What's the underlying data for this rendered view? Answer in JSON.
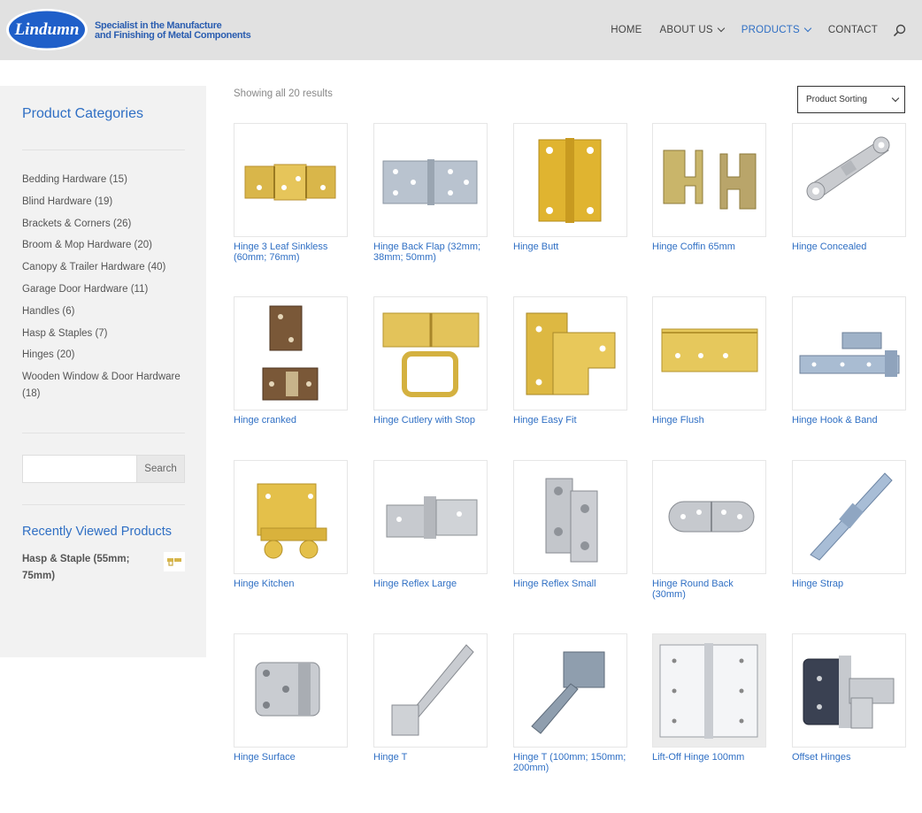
{
  "header": {
    "logo_text": "Lindumn",
    "tagline_line1": "Specialist in the Manufacture",
    "tagline_line2": "and Finishing of Metal Components",
    "nav": [
      {
        "label": "HOME",
        "has_dropdown": false,
        "active": false
      },
      {
        "label": "ABOUT US",
        "has_dropdown": true,
        "active": false
      },
      {
        "label": "PRODUCTS",
        "has_dropdown": true,
        "active": true
      },
      {
        "label": "CONTACT",
        "has_dropdown": false,
        "active": false
      }
    ],
    "search_icon": "search-icon"
  },
  "sidebar": {
    "categories_title": "Product Categories",
    "categories": [
      "Bedding Hardware (15)",
      "Blind Hardware (19)",
      "Brackets & Corners (26)",
      "Broom & Mop Hardware (20)",
      "Canopy & Trailer Hardware (40)",
      "Garage Door Hardware (11)",
      "Handles (6)",
      "Hasp & Staples (7)",
      "Hinges (20)",
      "Wooden Window & Door Hardware (18)"
    ],
    "search": {
      "placeholder": "",
      "button_label": "Search"
    },
    "recently_viewed_title": "Recently Viewed Products",
    "recently_viewed": [
      {
        "name": "Hasp & Staple (55mm; 75mm)"
      }
    ]
  },
  "main": {
    "results_text": "Showing all 20 results",
    "sorting_label": "Product Sorting",
    "products": [
      {
        "name": "Hinge 3 Leaf Sinkless (60mm; 76mm)"
      },
      {
        "name": "Hinge Back Flap (32mm; 38mm; 50mm)"
      },
      {
        "name": "Hinge Butt"
      },
      {
        "name": "Hinge Coffin 65mm"
      },
      {
        "name": "Hinge Concealed"
      },
      {
        "name": "Hinge cranked"
      },
      {
        "name": "Hinge Cutlery with Stop"
      },
      {
        "name": "Hinge Easy Fit"
      },
      {
        "name": "Hinge Flush"
      },
      {
        "name": "Hinge Hook & Band"
      },
      {
        "name": "Hinge Kitchen"
      },
      {
        "name": "Hinge Reflex Large"
      },
      {
        "name": "Hinge Reflex Small"
      },
      {
        "name": "Hinge Round Back (30mm)"
      },
      {
        "name": "Hinge Strap"
      },
      {
        "name": "Hinge Surface"
      },
      {
        "name": "Hinge T"
      },
      {
        "name": "Hinge T (100mm; 150mm; 200mm)"
      },
      {
        "name": "Lift-Off Hinge 100mm"
      },
      {
        "name": "Offset Hinges"
      }
    ]
  },
  "colors": {
    "accent": "#2f6fc4",
    "header_bg": "#e1e1e1",
    "sidebar_bg": "#f2f2f2",
    "logo_blue": "#2a5db0"
  }
}
